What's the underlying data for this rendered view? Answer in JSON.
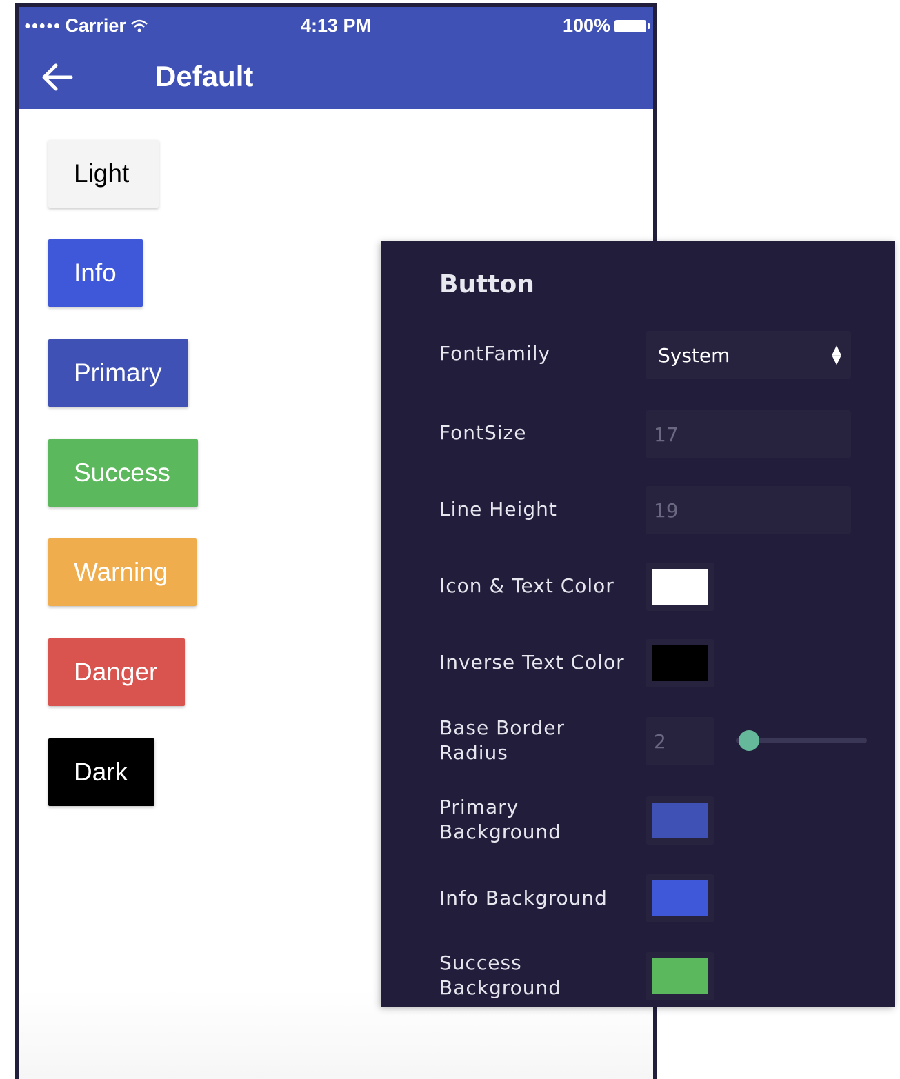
{
  "status_bar": {
    "signal": "●●●●●",
    "carrier": "Carrier",
    "wifi_icon": "wifi-icon",
    "time": "4:13 PM",
    "battery_percent": "100%"
  },
  "app_bar": {
    "back_icon": "arrow-left-icon",
    "title": "Default"
  },
  "buttons": [
    {
      "label": "Light",
      "color": "#f4f4f4"
    },
    {
      "label": "Info",
      "color": "#3f57d9"
    },
    {
      "label": "Primary",
      "color": "#3f51b5"
    },
    {
      "label": "Success",
      "color": "#5cb85c"
    },
    {
      "label": "Warning",
      "color": "#f0ad4e"
    },
    {
      "label": "Danger",
      "color": "#d9534f"
    },
    {
      "label": "Dark",
      "color": "#000000"
    }
  ],
  "panel": {
    "title": "Button",
    "font_family": {
      "label": "FontFamily",
      "value": "System"
    },
    "font_size": {
      "label": "FontSize",
      "placeholder": "17"
    },
    "line_height": {
      "label": "Line Height",
      "placeholder": "19"
    },
    "icon_text_color": {
      "label": "Icon & Text Color",
      "color": "#ffffff"
    },
    "inverse_text_color": {
      "label": "Inverse Text Color",
      "color": "#000000"
    },
    "base_border_radius": {
      "label_line1": "Base Border",
      "label_line2": "Radius",
      "placeholder": "2",
      "slider_fraction": 0.02
    },
    "primary_background": {
      "label_line1": "Primary",
      "label_line2": "Background",
      "color": "#3f51b5"
    },
    "info_background": {
      "label": "Info Background",
      "color": "#3f57d9"
    },
    "success_background": {
      "label_line1": "Success",
      "label_line2": "Background",
      "color": "#5cb85c"
    }
  }
}
